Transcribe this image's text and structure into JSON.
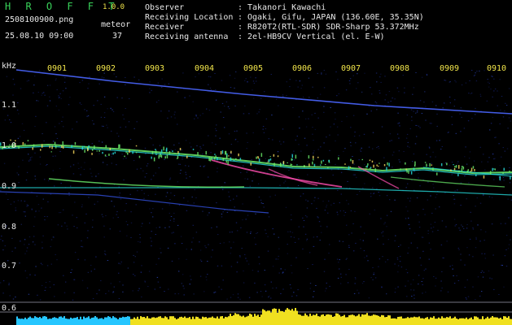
{
  "header": {
    "app_title": "H R O F F T",
    "app_version": "1.0.0",
    "file_name": "2508100900.png",
    "datetime": "25.08.10 09:00",
    "meteor_label": "meteor",
    "meteor_count": "37",
    "meta": [
      {
        "label": "Observer",
        "value": "Takanori Kawachi"
      },
      {
        "label": "Receiving Location",
        "value": "Ogaki, Gifu, JAPAN (136.60E, 35.35N)"
      },
      {
        "label": "Receiver",
        "value": "R820T2(RTL-SDR) SDR-Sharp 53.372MHz"
      },
      {
        "label": "Receiving antenna",
        "value": "2el-HB9CV Vertical (el. E-W)"
      }
    ],
    "separator": ":"
  },
  "axes": {
    "y_unit": "kHz",
    "time_ticks": [
      "0901",
      "0902",
      "0903",
      "0904",
      "0905",
      "0906",
      "0907",
      "0908",
      "0909",
      "0910"
    ],
    "freq_ticks": [
      "1.1",
      "1.0",
      "0.9",
      "0.8",
      "0.7",
      "0.6"
    ]
  },
  "colors": {
    "background": "#000000",
    "noise": "#1b2a8a",
    "trace_cyan": "#27e0e0",
    "trace_green": "#6cf06c",
    "trace_magenta": "#ff4fb0",
    "power_cyan": "#26c6ff",
    "power_yellow": "#f0e020",
    "label_yellow": "#f0e44a",
    "label_green": "#39d35a"
  }
}
